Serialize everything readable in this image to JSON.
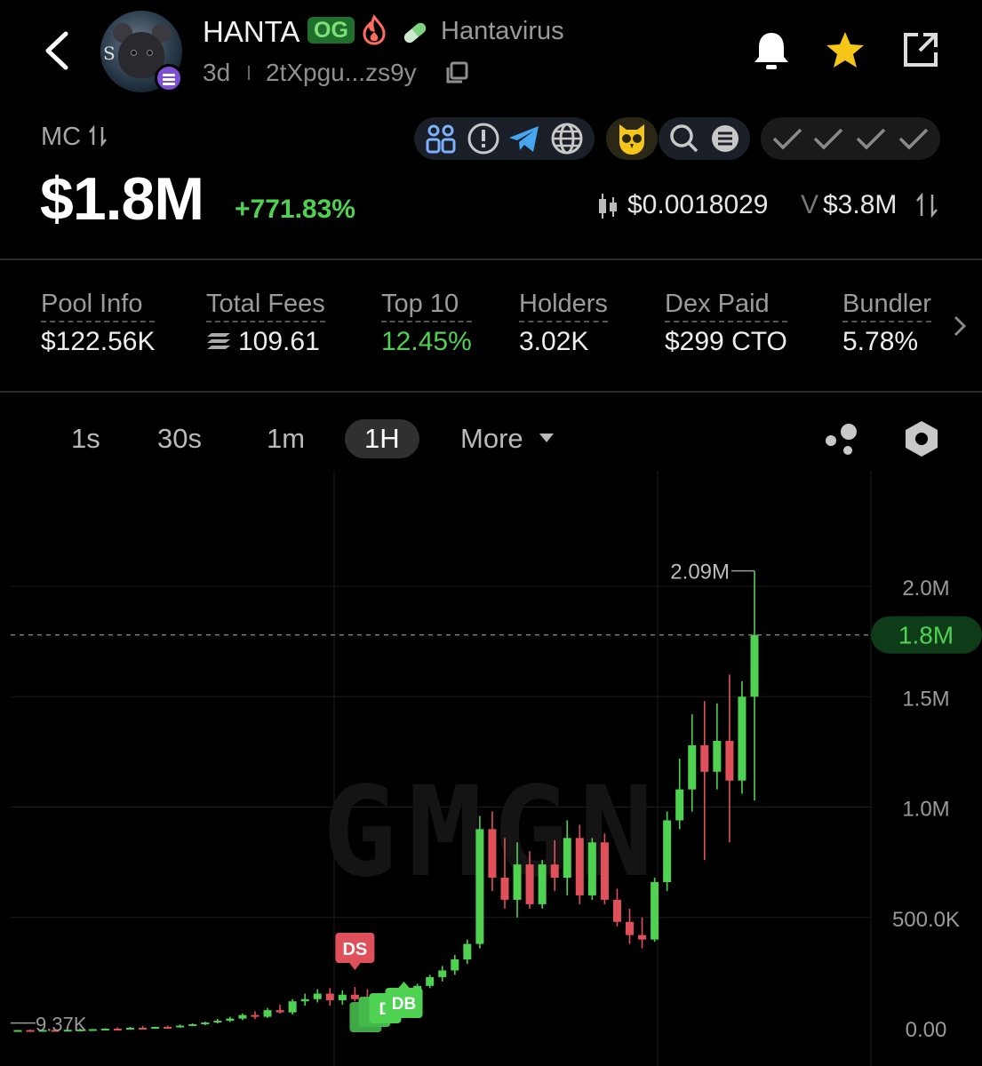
{
  "header": {
    "symbol": "HANTA",
    "badge": "OG",
    "name": "Hantavirus",
    "age": "3d",
    "address": "2tXpgu...zs9y",
    "avatar_letter": "S"
  },
  "market": {
    "mc_label": "MC",
    "mc_value": "$1.8M",
    "mc_change": "+771.83%",
    "price": "$0.0018029",
    "volume_label": "V",
    "volume": "$3.8M"
  },
  "stats": [
    {
      "label": "Pool Info",
      "value": "$122.56K"
    },
    {
      "label": "Total Fees",
      "value": "109.61"
    },
    {
      "label": "Top 10",
      "value": "12.45%"
    },
    {
      "label": "Holders",
      "value": "3.02K"
    },
    {
      "label": "Dex Paid",
      "value": "$299 CTO"
    },
    {
      "label": "Bundler",
      "value": "5.78%"
    }
  ],
  "timeframes": {
    "t1": "1s",
    "t2": "30s",
    "t3": "1m",
    "t4": "1H",
    "more": "More",
    "active": "1H"
  },
  "colors": {
    "up": "#4fd152",
    "down": "#e0505a",
    "background": "#000000",
    "accent_green": "#1d6f2b",
    "star": "#f5c518"
  },
  "icons": {
    "back": "chevron-left-icon",
    "bell": "bell-icon",
    "star": "star-icon",
    "share": "share-external-icon",
    "copy": "copy-icon",
    "fire": "fire-icon",
    "pill": "pill-icon",
    "tools": "indicators-icon",
    "settings": "hexagon-settings-icon"
  },
  "chart_data": {
    "type": "candlestick",
    "watermark": "GMGN",
    "y_tick_labels": [
      "2.0M",
      "1.5M",
      "1.0M",
      "500.0K",
      "0.00"
    ],
    "yticks": [
      2000000,
      1500000,
      1000000,
      500000,
      0
    ],
    "ylim": [
      0,
      2300000
    ],
    "current_value": 1800000,
    "current_label": "1.8M",
    "high_value": 2090000,
    "high_label": "2.09M",
    "low_label": "9.37K",
    "grid": true,
    "markers": [
      {
        "text": "DS",
        "type": "sell",
        "index": 27
      },
      {
        "text": "D",
        "type": "buy",
        "index": 28
      },
      {
        "text": "DB",
        "type": "buy",
        "index": 30
      }
    ],
    "candles": [
      [
        9400,
        10500,
        9100,
        9800
      ],
      [
        9800,
        12000,
        9500,
        9300
      ],
      [
        9300,
        11000,
        9000,
        10200
      ],
      [
        10200,
        12500,
        9800,
        9700
      ],
      [
        9700,
        13000,
        9500,
        11000
      ],
      [
        11000,
        16000,
        10500,
        12500
      ],
      [
        12500,
        15000,
        11000,
        14000
      ],
      [
        14000,
        18000,
        13000,
        16000
      ],
      [
        16000,
        22000,
        15000,
        14000
      ],
      [
        14000,
        24000,
        13500,
        20000
      ],
      [
        20000,
        28000,
        18000,
        19000
      ],
      [
        19000,
        25000,
        17000,
        24000
      ],
      [
        24000,
        30000,
        22000,
        22000
      ],
      [
        22000,
        35000,
        21000,
        30000
      ],
      [
        30000,
        40000,
        28000,
        36000
      ],
      [
        36000,
        48000,
        32000,
        44000
      ],
      [
        44000,
        60000,
        40000,
        52000
      ],
      [
        52000,
        70000,
        47000,
        62000
      ],
      [
        62000,
        85000,
        55000,
        78000
      ],
      [
        78000,
        95000,
        60000,
        70000
      ],
      [
        70000,
        110000,
        65000,
        100000
      ],
      [
        100000,
        125000,
        85000,
        90000
      ],
      [
        90000,
        150000,
        80000,
        140000
      ],
      [
        140000,
        175000,
        120000,
        150000
      ],
      [
        150000,
        195000,
        135000,
        175000
      ],
      [
        175000,
        200000,
        120000,
        145000
      ],
      [
        145000,
        190000,
        125000,
        170000
      ],
      [
        170000,
        205000,
        140000,
        150000
      ],
      [
        150000,
        195000,
        105000,
        125000
      ],
      [
        125000,
        170000,
        110000,
        155000
      ],
      [
        155000,
        185000,
        145000,
        165000
      ],
      [
        165000,
        195000,
        150000,
        185000
      ],
      [
        185000,
        220000,
        170000,
        210000
      ],
      [
        210000,
        260000,
        200000,
        250000
      ],
      [
        250000,
        300000,
        230000,
        280000
      ],
      [
        280000,
        350000,
        260000,
        330000
      ],
      [
        330000,
        420000,
        310000,
        400000
      ],
      [
        400000,
        980000,
        380000,
        920000
      ],
      [
        920000,
        1000000,
        640000,
        700000
      ],
      [
        700000,
        880000,
        560000,
        600000
      ],
      [
        600000,
        860000,
        520000,
        760000
      ],
      [
        760000,
        820000,
        560000,
        580000
      ],
      [
        580000,
        780000,
        560000,
        760000
      ],
      [
        760000,
        870000,
        640000,
        700000
      ],
      [
        700000,
        960000,
        620000,
        880000
      ],
      [
        880000,
        940000,
        580000,
        620000
      ],
      [
        620000,
        880000,
        600000,
        860000
      ],
      [
        860000,
        900000,
        580000,
        600000
      ],
      [
        600000,
        650000,
        480000,
        500000
      ],
      [
        500000,
        560000,
        400000,
        440000
      ],
      [
        440000,
        520000,
        380000,
        420000
      ],
      [
        420000,
        700000,
        410000,
        680000
      ],
      [
        680000,
        1000000,
        640000,
        960000
      ],
      [
        960000,
        1240000,
        920000,
        1100000
      ],
      [
        1100000,
        1440000,
        1000000,
        1300000
      ],
      [
        1300000,
        1500000,
        780000,
        1180000
      ],
      [
        1180000,
        1490000,
        1100000,
        1320000
      ],
      [
        1320000,
        1620000,
        860000,
        1140000
      ],
      [
        1140000,
        1590000,
        1080000,
        1520000
      ],
      [
        1520000,
        2090000,
        1050000,
        1800000
      ]
    ]
  }
}
